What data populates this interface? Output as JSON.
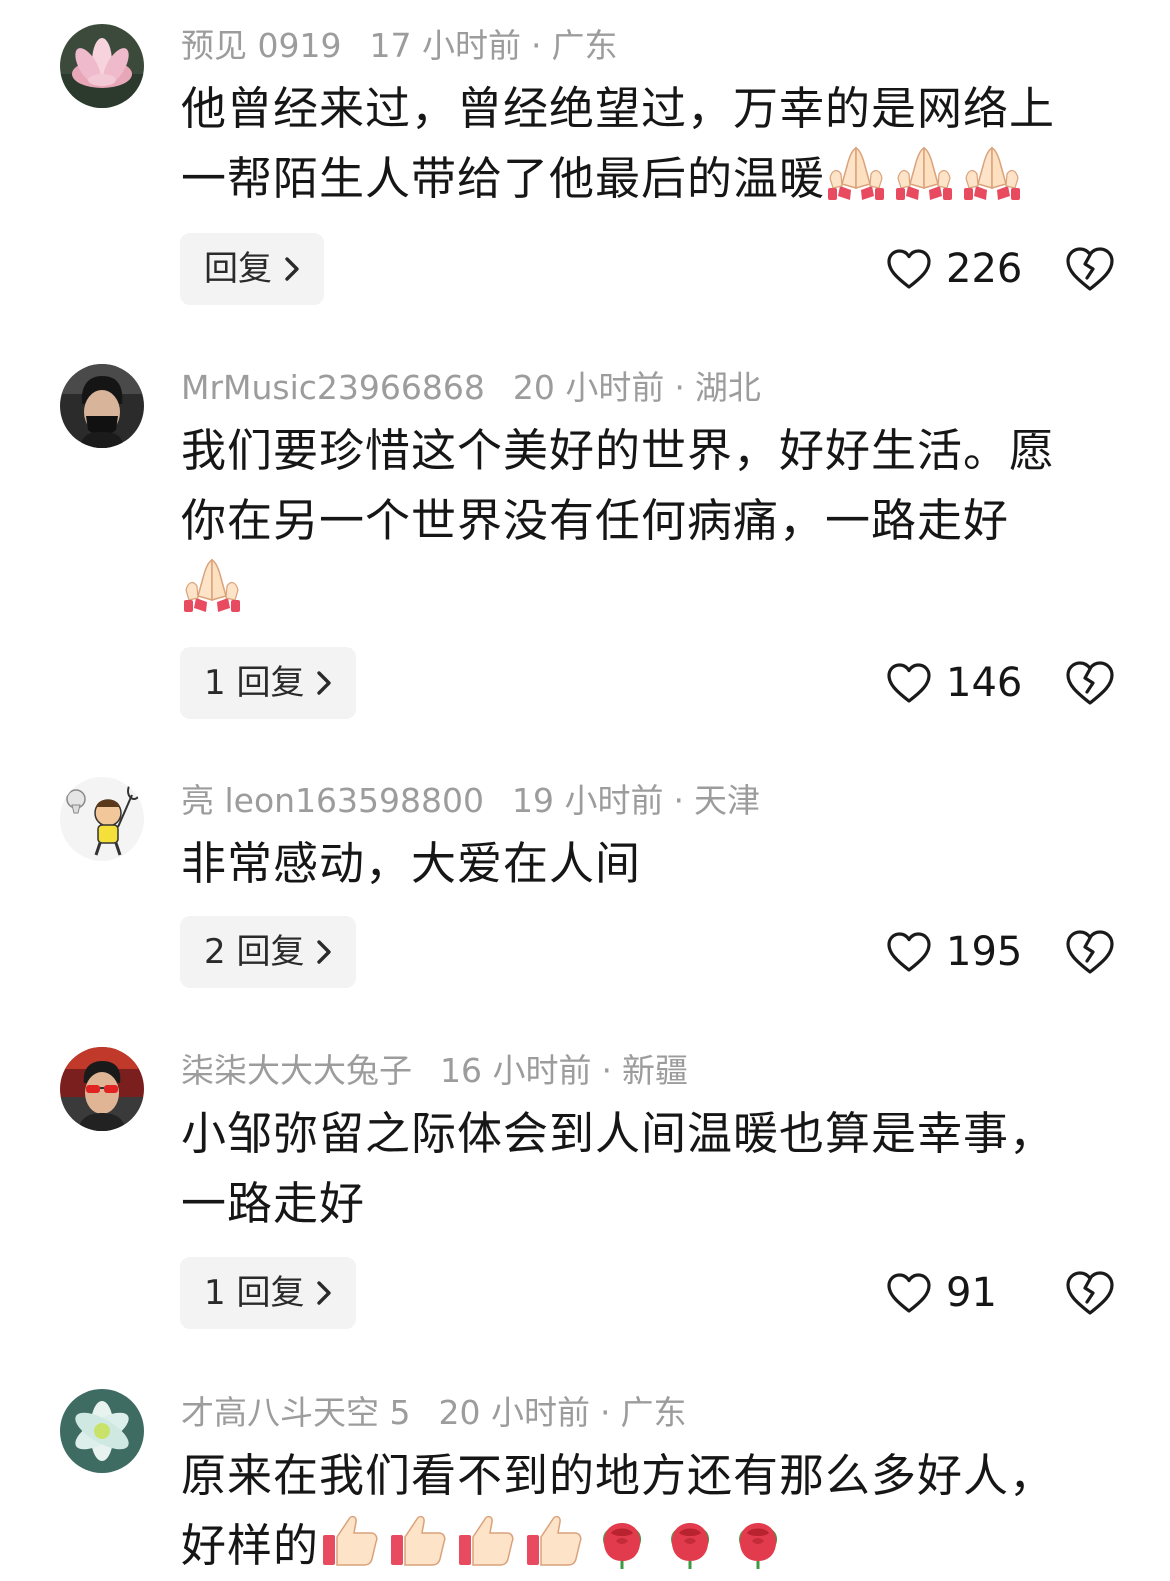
{
  "comments": [
    {
      "username": "预见 0919",
      "time": "17 小时前",
      "location": "广东",
      "lines": [
        "他曾经来过，曾经绝望过，万幸的是网络上",
        "一帮陌生人带给了他最后的温暖"
      ],
      "emojis": [
        "folded-hands",
        "folded-hands",
        "folded-hands"
      ],
      "reply_label": "回复",
      "likes": "226",
      "avatar": "lotus-flower"
    },
    {
      "username": "MrMusic23966868",
      "time": "20 小时前",
      "location": "湖北",
      "lines": [
        "我们要珍惜这个美好的世界，好好生活。愿",
        "你在另一个世界没有任何病痛，一路走好"
      ],
      "emojis": [
        "folded-hands"
      ],
      "reply_label": "1 回复",
      "likes": "146",
      "avatar": "man-with-mask"
    },
    {
      "username": "亮 leon163598800",
      "time": "19 小时前",
      "location": "天津",
      "lines": [
        "非常感动，大爱在人间"
      ],
      "emojis": [],
      "reply_label": "2 回复",
      "likes": "195",
      "avatar": "cartoon-badminton"
    },
    {
      "username": "柒柒大大大兔子",
      "time": "16 小时前",
      "location": "新疆",
      "lines": [
        "小邹弥留之际体会到人间温暖也算是幸事，",
        "一路走好"
      ],
      "emojis": [],
      "reply_label": "1 回复",
      "likes": "91",
      "avatar": "man-red-sunglasses"
    },
    {
      "username": "才高八斗天空 5",
      "time": "20 小时前",
      "location": "广东",
      "lines": [
        "原来在我们看不到的地方还有那么多好人，",
        "好样的"
      ],
      "emojis": [
        "thumbs-up",
        "thumbs-up",
        "thumbs-up",
        "thumbs-up",
        "rose",
        "rose",
        "rose"
      ],
      "avatar": "white-flower"
    }
  ],
  "icons": {
    "like": "heart-outline-icon",
    "dislike": "broken-heart-icon",
    "reply_chevron": "chevron-right-icon"
  }
}
